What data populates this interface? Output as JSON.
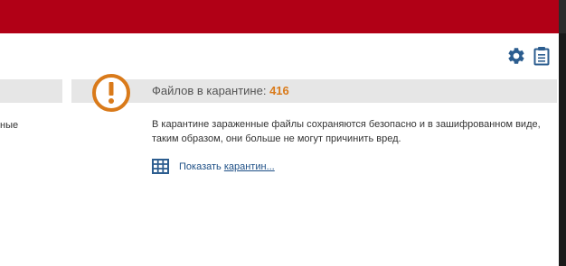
{
  "colors": {
    "top_bar": "#b10016",
    "accent_orange": "#d97a1a",
    "icon_blue": "#2c5d8f",
    "header_band": "#e6e6e6",
    "link": "#1d4f86"
  },
  "toolbar": {
    "settings_icon": "gear-icon",
    "report_icon": "clipboard-icon"
  },
  "left_panel": {
    "partial_text": "ные"
  },
  "quarantine": {
    "alert_icon": "exclamation-circle-icon",
    "title_label": "Файлов в карантине: ",
    "count": "416",
    "description": "В карантине зараженные файлы сохраняются безопасно и в зашифрованном виде, таким образом, они больше не могут причинить вред.",
    "link_icon": "grid-icon",
    "show_link_prefix": "Показать ",
    "show_link_underlined": "карантин...",
    "show_link_label": "Показать карантин..."
  }
}
